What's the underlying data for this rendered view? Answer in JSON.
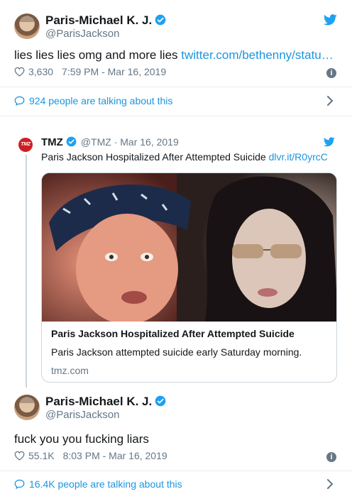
{
  "tweet1": {
    "name": "Paris-Michael K. J.",
    "handle": "@ParisJackson",
    "text": "lies lies lies omg and more lies ",
    "link": "twitter.com/bethenny/statu…",
    "likes": "3,630",
    "time": "7:59 PM - Mar 16, 2019",
    "talking": "924 people are talking about this"
  },
  "quoted": {
    "name": "TMZ",
    "handle_date": "@TMZ · Mar 16, 2019",
    "logo": "TMZ",
    "text": "Paris Jackson Hospitalized After Attempted Suicide ",
    "link": "dlvr.it/R0yrcC",
    "card": {
      "title": "Paris Jackson Hospitalized After Attempted Suicide",
      "description": "Paris Jackson attempted suicide early Saturday morning.",
      "domain": "tmz.com"
    }
  },
  "tweet2": {
    "name": "Paris-Michael K. J.",
    "handle": "@ParisJackson",
    "text": "fuck you you fucking liars",
    "likes": "55.1K",
    "time": "8:03 PM - Mar 16, 2019",
    "talking": "16.4K people are talking about this"
  },
  "colors": {
    "link": "#1b95e0",
    "muted": "#657786",
    "verified": "#1da1f2",
    "tmz": "#cc1f25"
  },
  "icons": [
    "verified-badge-icon",
    "twitter-bird-icon",
    "heart-icon",
    "info-icon",
    "comment-bubble-icon",
    "chevron-right-icon"
  ]
}
